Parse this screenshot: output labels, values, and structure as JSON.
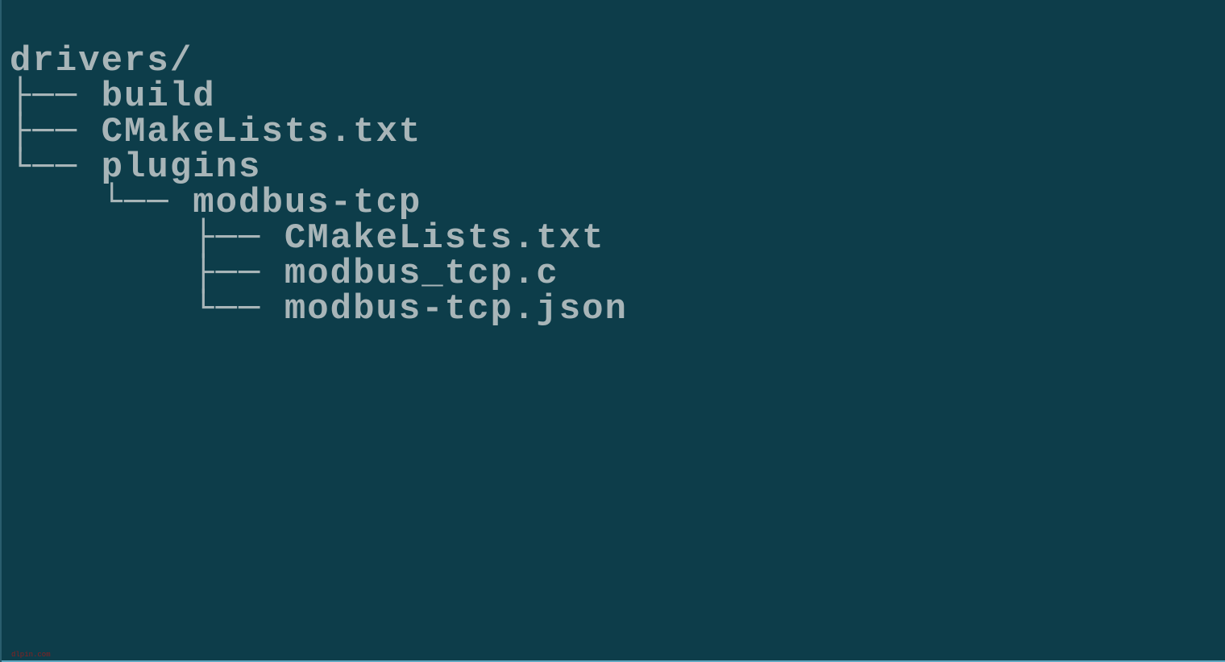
{
  "tree": {
    "root": "drivers/",
    "children": [
      {
        "prefix": "├── ",
        "name": "build"
      },
      {
        "prefix": "├── ",
        "name": "CMakeLists.txt"
      },
      {
        "prefix": "└── ",
        "name": "plugins",
        "children": [
          {
            "prefix": "    └── ",
            "name": "modbus-tcp",
            "children": [
              {
                "prefix": "        ├── ",
                "name": "CMakeLists.txt"
              },
              {
                "prefix": "        ├── ",
                "name": "modbus_tcp.c"
              },
              {
                "prefix": "        └── ",
                "name": "modbus-tcp.json"
              }
            ]
          }
        ]
      }
    ]
  },
  "watermark": "dlpin.com"
}
